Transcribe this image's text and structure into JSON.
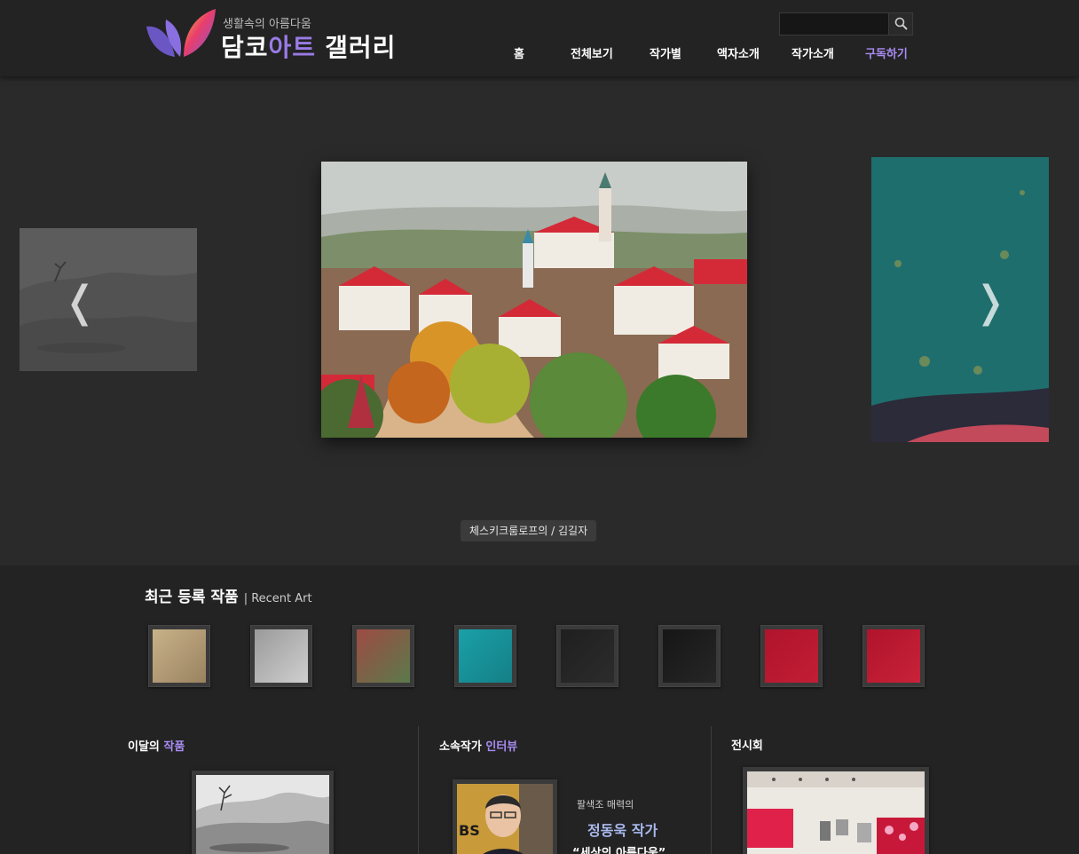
{
  "header": {
    "tagline": "생활속의 아름다움",
    "brand": {
      "part1": "담코",
      "part2": "아트",
      "part3": "갤러리"
    },
    "search": {
      "placeholder": "",
      "value": ""
    },
    "nav": [
      {
        "label": "홈",
        "active": false
      },
      {
        "label": "전체보기",
        "active": false
      },
      {
        "label": "작가별",
        "active": false
      },
      {
        "label": "액자소개",
        "active": false
      },
      {
        "label": "작가소개",
        "active": false
      },
      {
        "label": "구독하기",
        "active": true
      }
    ]
  },
  "slider": {
    "caption": "체스키크룸로프의 / 김길자",
    "prev_glyph": "❬",
    "next_glyph": "❭"
  },
  "recent": {
    "title": "최근 등록 작품",
    "subtitle": "| Recent Art",
    "thumbnails": [
      {
        "colors": [
          "#c8b289",
          "#9a8260"
        ]
      },
      {
        "colors": [
          "#9a9a9a",
          "#cfcfcf"
        ]
      },
      {
        "colors": [
          "#9e4b44",
          "#5a7a4a"
        ]
      },
      {
        "colors": [
          "#1aa0a8",
          "#157f86"
        ]
      },
      {
        "colors": [
          "#1f1f1f",
          "#2c2c2c"
        ]
      },
      {
        "colors": [
          "#161616",
          "#262626"
        ]
      },
      {
        "colors": [
          "#b0142c",
          "#c21e35"
        ]
      },
      {
        "colors": [
          "#b0142c",
          "#c82238"
        ]
      }
    ]
  },
  "sections": {
    "monthly": {
      "title": "이달의",
      "accent": "작품"
    },
    "interview": {
      "title": "소속작가",
      "accent": "인터뷰",
      "subtitle": "팔색조 매력의",
      "name": "정동욱 작가",
      "quote": "“세상의 아름다움”",
      "badge": "BS"
    },
    "exhibition": {
      "title": "전시회"
    }
  },
  "colors": {
    "accent": "#a88bf0",
    "background": "#232323",
    "slider_bg": "#2a2a2a"
  }
}
